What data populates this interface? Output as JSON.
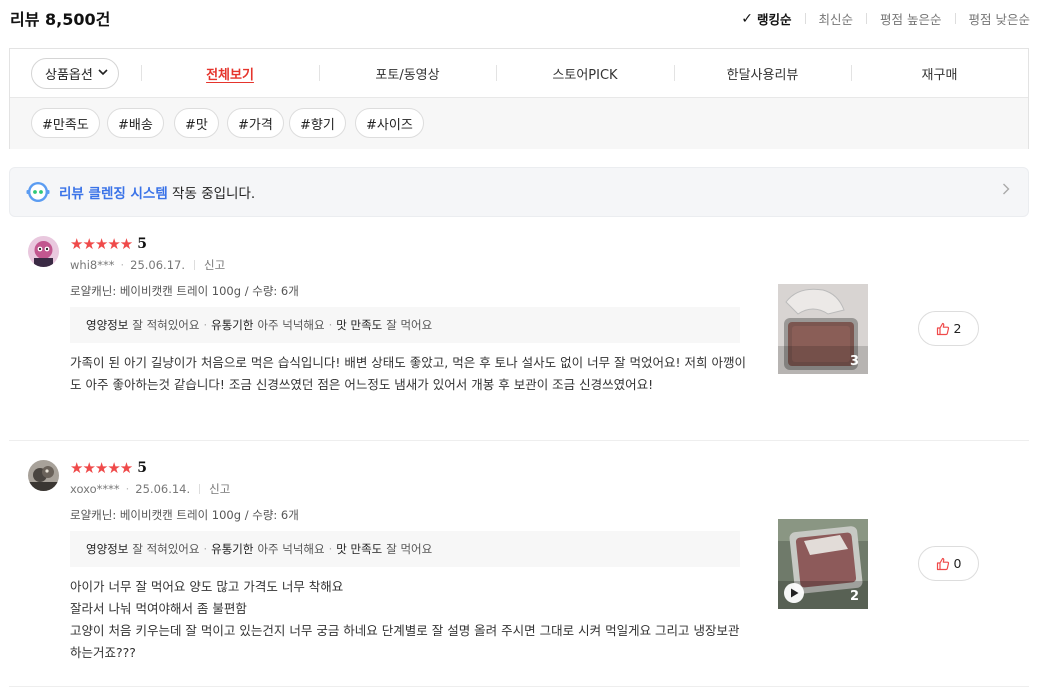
{
  "header": {
    "total": "리뷰 8,500건",
    "sorts": [
      {
        "label": "랭킹순",
        "active": true
      },
      {
        "label": "최신순",
        "active": false
      },
      {
        "label": "평점 높은순",
        "active": false
      },
      {
        "label": "평점 낮은순",
        "active": false
      }
    ]
  },
  "filter": {
    "option_label": "상품옵션",
    "tabs": [
      {
        "label": "전체보기",
        "active": true
      },
      {
        "label": "포토/동영상",
        "active": false
      },
      {
        "label": "스토어PICK",
        "active": false
      },
      {
        "label": "한달사용리뷰",
        "active": false
      },
      {
        "label": "재구매",
        "active": false
      }
    ],
    "tags": [
      "#만족도",
      "#배송",
      "#맛",
      "#가격",
      "#향기",
      "#사이즈"
    ]
  },
  "cleansing": {
    "strong": "리뷰 클렌징 시스템",
    "rest": " 작동 중입니다."
  },
  "colors": {
    "accent_red": "#e5342c",
    "star": "#ef4a4a",
    "link_blue": "#3a73e8"
  },
  "reviews": [
    {
      "rating": 5,
      "stars_text": "★★★★★",
      "score": "5",
      "user": "whi8***",
      "date": "25.06.17.",
      "report": "신고",
      "option": "로얄캐닌: 베이비캣캔 트레이 100g / 수량: 6개",
      "survey": [
        {
          "key": "영양정보",
          "value": "잘 적혀있어요"
        },
        {
          "key": "유통기한",
          "value": "아주 넉넉해요"
        },
        {
          "key": "맛 만족도",
          "value": "잘 먹어요"
        }
      ],
      "body": "가족이 된 아기 길냥이가 처음으로 먹은 습식입니다! 배변 상태도 좋았고, 먹은 후 토나 설사도 없이 너무 잘 먹었어요! 저희 아깽이도 아주 좋아하는것 같습니다! 조금 신경쓰였던 점은 어느정도 냄새가 있어서 개봉 후 보관이 조금 신경쓰였어요!",
      "photo_count": "3",
      "likes": "2",
      "is_video": false
    },
    {
      "rating": 5,
      "stars_text": "★★★★★",
      "score": "5",
      "user": "xoxo****",
      "date": "25.06.14.",
      "report": "신고",
      "option": "로얄캐닌: 베이비캣캔 트레이 100g / 수량: 6개",
      "survey": [
        {
          "key": "영양정보",
          "value": "잘 적혀있어요"
        },
        {
          "key": "유통기한",
          "value": "아주 넉넉해요"
        },
        {
          "key": "맛 만족도",
          "value": "잘 먹어요"
        }
      ],
      "body_lines": [
        "아이가 너무 잘 먹어요 양도 많고 가격도 너무 착해요",
        "잘라서 나눠 먹여야해서 좀 불편함",
        "고양이 처음 키우는데 잘 먹이고 있는건지 너무 궁금 하네요 단계별로 잘 설명 올려 주시면 그대로 시켜 먹일게요 그리고 냉장보관하는거죠???"
      ],
      "photo_count": "2",
      "likes": "0",
      "is_video": true
    }
  ]
}
